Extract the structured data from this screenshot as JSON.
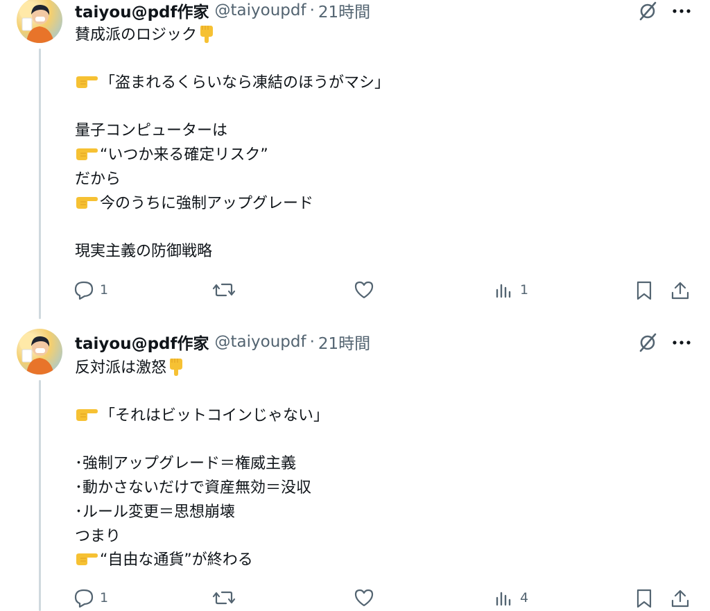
{
  "tweets": [
    {
      "author": {
        "display_name": "taiyou@pdf作家",
        "handle": "@taiyoupdf",
        "separator": "·",
        "time": "21時間"
      },
      "lines": [
        {
          "emoji": "",
          "text": "賛成派のロジック",
          "trailing_emoji": "backhand-index-pointing-down"
        },
        {
          "emoji": "backhand-index-pointing-right",
          "text": "「盗まれるくらいなら凍結のほうがマシ」"
        },
        {
          "emoji": "",
          "text": "量子コンピューターは"
        },
        {
          "emoji": "backhand-index-pointing-right",
          "text": "“いつか来る確定リスク”"
        },
        {
          "emoji": "",
          "text": "だから"
        },
        {
          "emoji": "backhand-index-pointing-right",
          "text": "今のうちに強制アップグレード"
        },
        {
          "emoji": "",
          "text": "現実主義の防御戦略"
        }
      ],
      "actions": {
        "reply_count": "1",
        "repost_count": "",
        "like_count": "",
        "views_count": "1"
      }
    },
    {
      "author": {
        "display_name": "taiyou@pdf作家",
        "handle": "@taiyoupdf",
        "separator": "·",
        "time": "21時間"
      },
      "lines": [
        {
          "emoji": "",
          "text": "反対派は激怒",
          "trailing_emoji": "backhand-index-pointing-down"
        },
        {
          "emoji": "backhand-index-pointing-right",
          "text": "「それはビットコインじゃない」"
        },
        {
          "emoji": "",
          "text": "･強制アップグレード＝権威主義"
        },
        {
          "emoji": "",
          "text": "･動かさないだけで資産無効＝没収"
        },
        {
          "emoji": "",
          "text": "･ルール変更＝思想崩壊"
        },
        {
          "emoji": "",
          "text": "つまり"
        },
        {
          "emoji": "backhand-index-pointing-right",
          "text": "“自由な通貨”が終わる"
        }
      ],
      "actions": {
        "reply_count": "1",
        "repost_count": "",
        "like_count": "",
        "views_count": "4"
      }
    }
  ],
  "icons": [
    "grok-icon",
    "more-icon",
    "reply-icon",
    "repost-icon",
    "like-icon",
    "views-icon",
    "bookmark-icon",
    "share-icon"
  ],
  "colors": {
    "text": "#0f1419",
    "secondary": "#536471",
    "thread_line": "#cfd9de",
    "emoji": "#f6c133"
  }
}
